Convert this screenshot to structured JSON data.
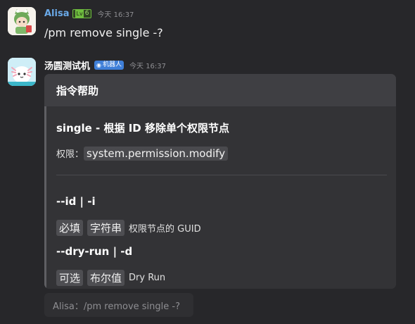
{
  "messages": [
    {
      "author": "Alisa",
      "level_badge": {
        "prefix": "Lv",
        "value": "6"
      },
      "time": "今天 16:37",
      "text": "/pm remove single -?"
    },
    {
      "author": "汤圆测试机",
      "bot_badge": "机器人",
      "time": "今天 16:37",
      "card": {
        "header": "指令帮助",
        "title": "single - 根据 ID 移除单个权限节点",
        "permission_label": "权限：",
        "permission_value": "system.permission.modify",
        "options": [
          {
            "name": "--id | -i",
            "tags": [
              "必填",
              "字符串"
            ],
            "description": "权限节点的 GUID"
          },
          {
            "name": "--dry-run | -d",
            "tags": [
              "可选",
              "布尔值"
            ],
            "description": "Dry Run"
          }
        ]
      }
    }
  ],
  "input": {
    "text": "Alisa：/pm remove single -?"
  },
  "colors": {
    "background": "#27272a",
    "username_user": "#6aa9e8",
    "level_badge": "#6fbd3f",
    "bot_badge": "#3f7fd8",
    "card": "#3a3a3d"
  }
}
